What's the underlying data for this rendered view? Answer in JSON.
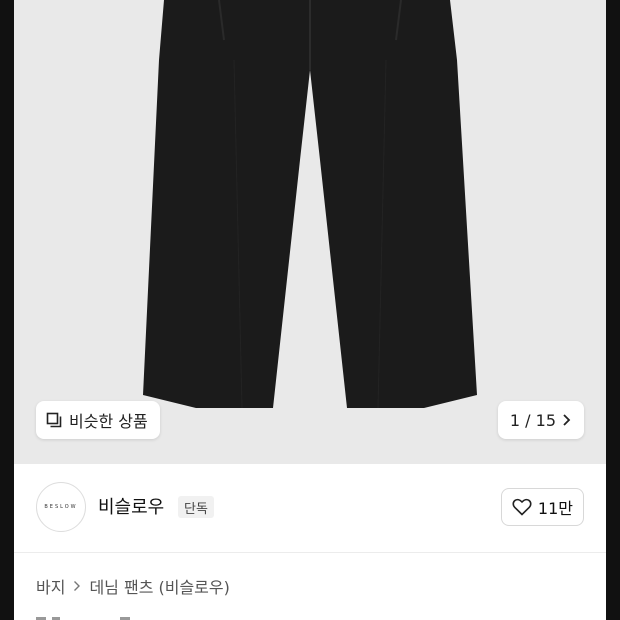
{
  "hero": {
    "similar_label": "비슷한 상품",
    "similar_icon": "copy-icon",
    "counter_label": "1 / 15",
    "counter_icon": "chevron-right-icon",
    "image_subject": "black pants"
  },
  "brand": {
    "logo_text": "BESLOW",
    "name": "비슬로우",
    "exclusive_badge": "단독",
    "like_label": "11만",
    "like_icon": "heart-outline-icon"
  },
  "breadcrumb": {
    "category": "바지",
    "subcategory": "데님 팬츠 (비슬로우)",
    "separator_icon": "chevron-right-icon"
  },
  "colors": {
    "hero_background": "#e9e9e9",
    "pants": "#1b1b1b",
    "frame": "#111111"
  }
}
